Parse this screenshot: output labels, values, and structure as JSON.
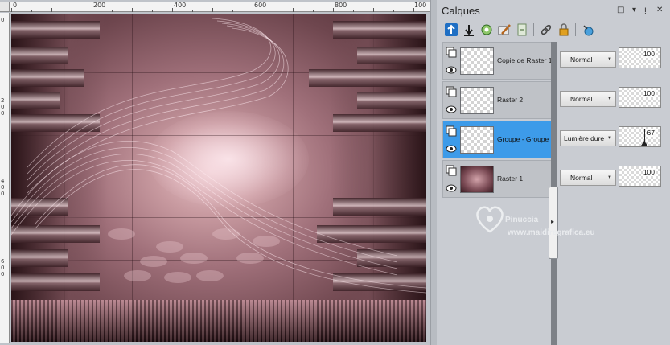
{
  "ruler": {
    "h_labels": [
      "0",
      "200",
      "400",
      "600",
      "800",
      "100"
    ],
    "v_labels": [
      "0",
      "2",
      "0",
      "0",
      "4",
      "0",
      "0",
      "6",
      "0",
      "0"
    ]
  },
  "panel": {
    "title": "Calques",
    "window_controls": [
      "□",
      "▾",
      "ᴉ",
      "✕"
    ],
    "toolbar_icons": [
      "new-raster-layer-icon",
      "new-vector-layer-icon",
      "new-mask-layer-icon",
      "layer-properties-icon",
      "promote-icon",
      "link-icon",
      "lock-icon",
      "delete-icon"
    ]
  },
  "layers": [
    {
      "name": "Copie de Raster 1",
      "blend": "Normal",
      "opacity": "100",
      "selected": false,
      "thumb": "transparent"
    },
    {
      "name": "Raster 2",
      "blend": "Normal",
      "opacity": "100",
      "selected": false,
      "thumb": "transparent"
    },
    {
      "name": "Groupe - Groupe",
      "blend": "Lumière dure",
      "opacity": "67",
      "selected": true,
      "thumb": "transparent"
    },
    {
      "name": "Raster 1",
      "blend": "Normal",
      "opacity": "100",
      "selected": false,
      "thumb": "image"
    }
  ],
  "watermark": {
    "line1": "Pinuccia",
    "line2": "www.maidiregrafica.eu"
  },
  "colors": {
    "selection": "#3d9be9",
    "panel_bg": "#c9ccd2",
    "image_accent": "#a0707a"
  }
}
